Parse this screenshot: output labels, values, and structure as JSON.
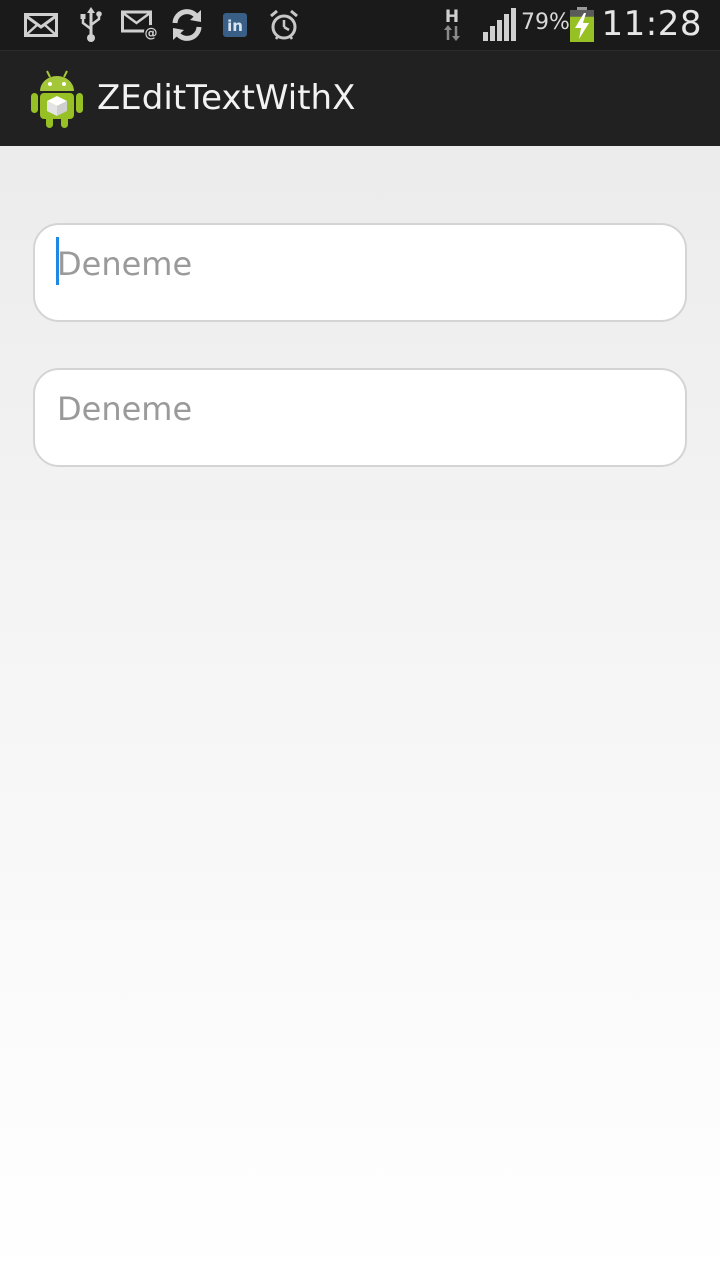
{
  "status_bar": {
    "icons": [
      "mail-icon",
      "usb-icon",
      "email-at-icon",
      "sync-icon",
      "linkedin-icon",
      "alarm-icon",
      "hspa-data-icon",
      "signal-icon",
      "battery-charging-icon"
    ],
    "network_type": "H",
    "linkedin_text": "in",
    "battery_percent": "79%",
    "battery_level": 0.79,
    "time": "11:28"
  },
  "action_bar": {
    "app_icon": "android-robot-icon",
    "title": "ZEditTextWithX"
  },
  "form": {
    "fields": [
      {
        "placeholder": "Deneme",
        "value": "",
        "focused": true
      },
      {
        "placeholder": "Deneme",
        "value": "",
        "focused": false
      }
    ]
  },
  "colors": {
    "status_bar": "#1a1a1a",
    "action_bar": "#212121",
    "caret": "#1e88e5",
    "android_green": "#97c024"
  }
}
